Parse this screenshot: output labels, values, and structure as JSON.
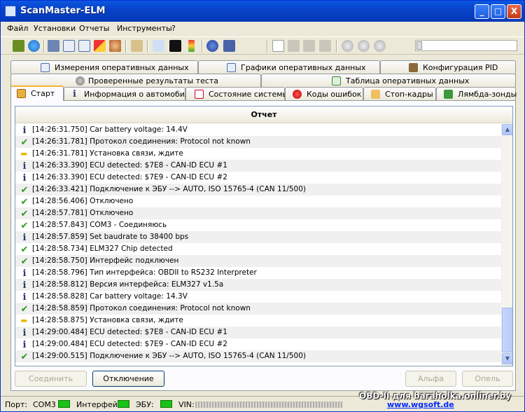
{
  "window": {
    "title": "ScanMaster-ELM"
  },
  "title_buttons": {
    "minimize": "_",
    "maximize": "□",
    "close": "X"
  },
  "menu": [
    "Файл",
    "Установки",
    "Отчеты",
    "Инструменты",
    "?"
  ],
  "toolbar_icons": [
    "connect-wizard-icon",
    "globe-icon",
    "dashboard-icon",
    "table-icon",
    "chart-icon",
    "pie-icon",
    "user-icon",
    "clipboard-icon",
    "search-icon",
    "terminal-icon",
    "battery-icon",
    "info-icon",
    "help-book-icon",
    "new-doc-icon",
    "open-icon",
    "save-icon",
    "print-icon",
    "play-icon",
    "stop-icon",
    "record-icon"
  ],
  "tabs_row1": [
    {
      "label": "Измерения оперативных данных",
      "icon": "table-icon"
    },
    {
      "label": "Графики оперативных данных",
      "icon": "chart-icon"
    },
    {
      "label": "Конфигурация PID",
      "icon": "wrench-icon"
    }
  ],
  "tabs_row2": [
    {
      "label": "Проверенные результаты теста",
      "icon": "gear-icon"
    },
    {
      "label": "Таблица оперативных данных",
      "icon": "grid-icon"
    }
  ],
  "tabs_row3": [
    {
      "label": "Старт",
      "icon": "home-icon"
    },
    {
      "label": "Информация о автомобиле",
      "icon": "info-icon"
    },
    {
      "label": "Состояние системы",
      "icon": "checkbox-icon"
    },
    {
      "label": "Коды ошибок",
      "icon": "error-icon"
    },
    {
      "label": "Стоп-кадры",
      "icon": "hand-icon"
    },
    {
      "label": "Лямбда-зонды",
      "icon": "sensor-icon"
    }
  ],
  "log": {
    "header": "Отчет",
    "rows": [
      {
        "type": "info",
        "text": "[14:26:31.750] Car battery voltage: 14.4V"
      },
      {
        "type": "ok",
        "text": "[14:26:31.781] Протокол соединения: Protocol not known"
      },
      {
        "type": "arrow",
        "text": "[14:26:31.781] Установка связи, ждите"
      },
      {
        "type": "info",
        "text": "[14:26:33.390] ECU detected: $7E8 - CAN-ID ECU #1"
      },
      {
        "type": "info",
        "text": "[14:26:33.390] ECU detected: $7E9 - CAN-ID ECU #2"
      },
      {
        "type": "ok",
        "text": "[14:26:33.421] Подключение к ЭБУ --> AUTO, ISO 15765-4 (CAN 11/500)"
      },
      {
        "type": "ok",
        "text": "[14:28:56.406] Отключено"
      },
      {
        "type": "ok",
        "text": "[14:28:57.781] Отключено"
      },
      {
        "type": "ok",
        "text": "[14:28:57.843] COM3 - Соединяюсь"
      },
      {
        "type": "info",
        "text": "[14:28:57.859] Set baudrate to 38400 bps"
      },
      {
        "type": "ok",
        "text": "[14:28:58.734] ELM327 Chip detected"
      },
      {
        "type": "ok",
        "text": "[14:28:58.750] Интерфейс подключен"
      },
      {
        "type": "info",
        "text": "[14:28:58.796] Тип интерфейса: OBDII to RS232 Interpreter"
      },
      {
        "type": "info",
        "text": "[14:28:58.812] Версия интерфейса: ELM327 v1.5a"
      },
      {
        "type": "info",
        "text": "[14:28:58.828] Car battery voltage: 14.3V"
      },
      {
        "type": "ok",
        "text": "[14:28:58.859] Протокол соединения: Protocol not known"
      },
      {
        "type": "arrow",
        "text": "[14:28:58.875] Установка связи, ждите"
      },
      {
        "type": "info",
        "text": "[14:29:00.484] ECU detected: $7E8 - CAN-ID ECU #1"
      },
      {
        "type": "info",
        "text": "[14:29:00.484] ECU detected: $7E9 - CAN-ID ECU #2"
      },
      {
        "type": "ok",
        "text": "[14:29:00.515] Подключение к ЭБУ --> AUTO, ISO 15765-4 (CAN 11/500)"
      }
    ]
  },
  "buttons": {
    "connect": "Соединить",
    "disconnect": "Отключение",
    "alfa": "Альфа Ромео",
    "opel": "Опель"
  },
  "status": {
    "port_label": "Порт:",
    "port_value": "COM3",
    "interface_label": "Интерфейс:",
    "ecu_label": "ЭБУ:",
    "vin_label": "VIN:",
    "led_color": "#19c216"
  },
  "watermark": {
    "line1": "OBD-II для baraholka.onliner.by",
    "line2": "www.wgsoft.de"
  }
}
